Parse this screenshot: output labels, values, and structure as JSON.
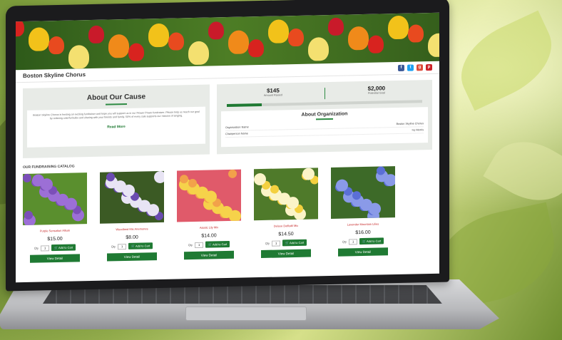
{
  "site": {
    "org_name": "Boston Skyline Chorus",
    "social": [
      {
        "icon": "facebook-icon",
        "glyph": "f",
        "color": "#3b5998"
      },
      {
        "icon": "twitter-icon",
        "glyph": "t",
        "color": "#1da1f2"
      },
      {
        "icon": "google-plus-icon",
        "glyph": "g",
        "color": "#dd4b39"
      },
      {
        "icon": "pinterest-icon",
        "glyph": "p",
        "color": "#cb2027"
      }
    ]
  },
  "cause": {
    "title": "About Our Cause",
    "body": "Boston Skyline Chorus is hosting an exciting fundraiser and hope you will support us in our Flower Power fundraiser. Please help us reach our goal by ordering colorful bulbs and sharing with your friends and family. 50% of every sale supports our mission of singing.",
    "read_more": "Read More"
  },
  "organization": {
    "raised_value": "$145",
    "raised_label": "Amount Raised",
    "goal_value": "$2,000",
    "goal_label": "Potential Goal",
    "progress_fraction": 0.18,
    "title": "About Organization",
    "rows": [
      {
        "label": "Organization Name",
        "value": "Boston Skyline Chorus"
      },
      {
        "label": "Chairperson Name",
        "value": "Ivy Morris"
      }
    ]
  },
  "catalog": {
    "title": "OUR FUNDRAISING CATALOG",
    "qty_label": "Qty",
    "qty_value": "1",
    "add_label": "Add to Cart",
    "detail_label": "View Detail",
    "products": [
      {
        "name": "Purple Sensation Allium",
        "price": "$15.00",
        "palette": [
          "#7b4fb8",
          "#9c6fd6",
          "#5a8f2e"
        ]
      },
      {
        "name": "Woodland Mix Anemones",
        "price": "$8.00",
        "palette": [
          "#6a4bb0",
          "#e8e4f4",
          "#3b5a24"
        ]
      },
      {
        "name": "Asiatic Lily Mix",
        "price": "$14.00",
        "palette": [
          "#f2a24a",
          "#f6d24a",
          "#e05a6a"
        ]
      },
      {
        "name": "Deluxe Daffodil Mix",
        "price": "$14.50",
        "palette": [
          "#f4d03f",
          "#fbf4c8",
          "#4f7a2a"
        ]
      },
      {
        "name": "Lavender Mountain Lilies",
        "price": "$16.00",
        "palette": [
          "#5b6fd6",
          "#8a9ae8",
          "#3d6a28"
        ]
      }
    ]
  },
  "colors": {
    "accent_green": "#1f7a33",
    "price_red": "#c62828"
  }
}
